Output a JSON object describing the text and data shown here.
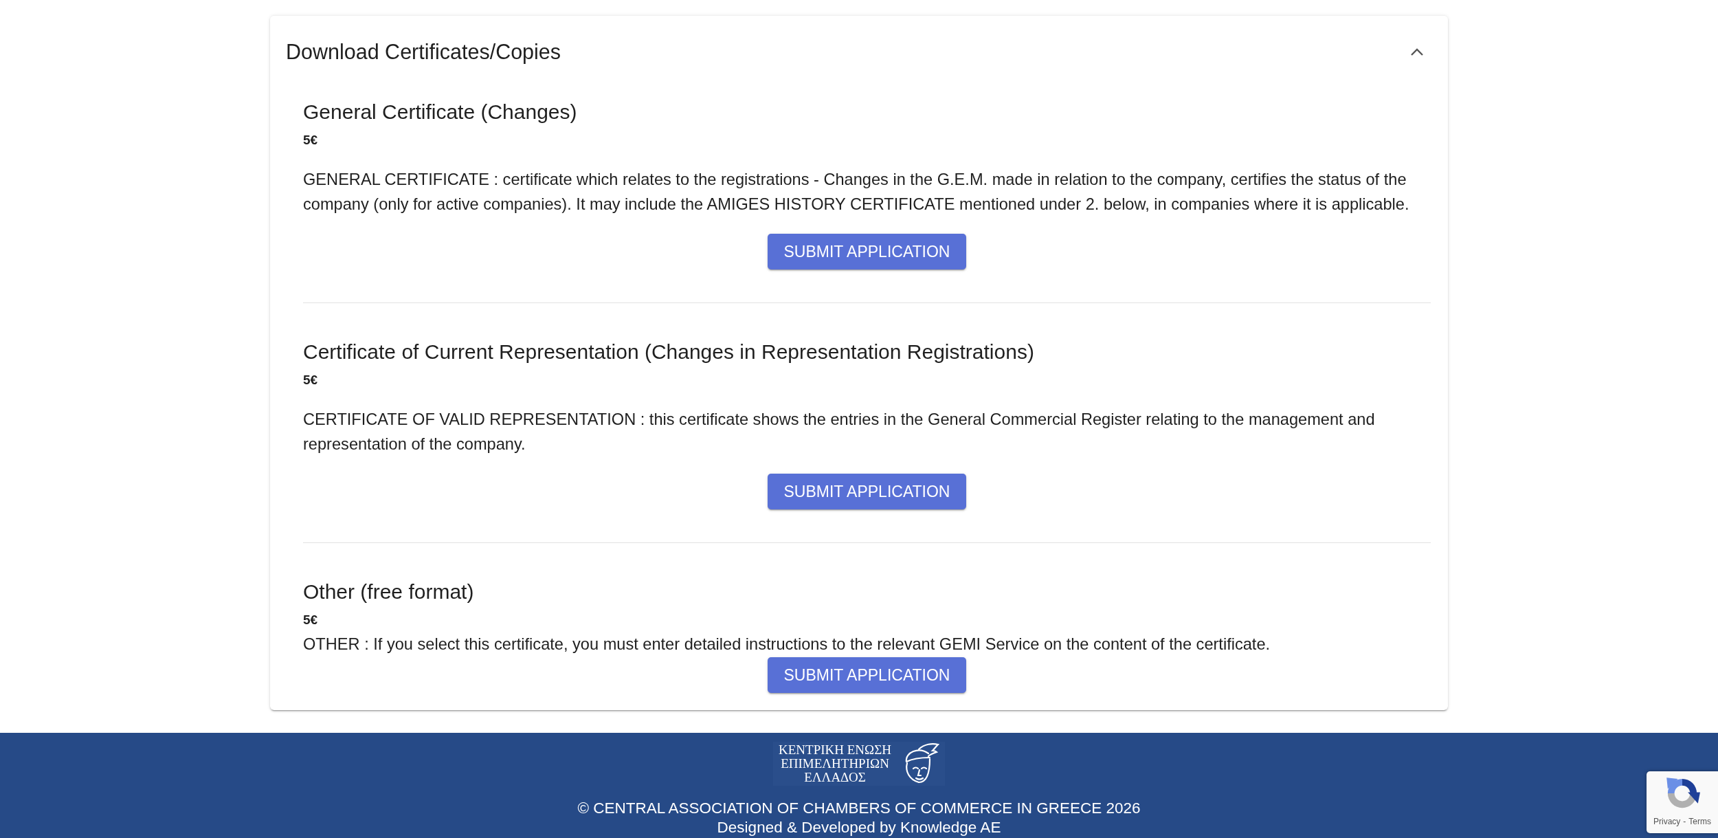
{
  "panel": {
    "title": "Download Certificates/Copies",
    "expanded": true
  },
  "certificates": [
    {
      "title": "General Certificate (Changes)",
      "price": "5€",
      "description": "GENERAL CERTIFICATE : certificate which relates to the registrations - Changes in the G.E.M. made in relation to the company, certifies the status of the company (only for active companies). It may include the AMIGES HISTORY CERTIFICATE mentioned under 2. below, in companies where it is applicable.",
      "button": "SUBMIT APPLICATION"
    },
    {
      "title": "Certificate of Current Representation (Changes in Representation Registrations)",
      "price": "5€",
      "description": "CERTIFICATE OF VALID REPRESENTATION : this certificate shows the entries in the General Commercial Register relating to the management and representation of the company.",
      "button": "SUBMIT APPLICATION"
    },
    {
      "title": "Other (free format)",
      "price": "5€",
      "description": "OTHER : If you select this certificate, you must enter detailed instructions to the relevant GEMI Service on the content of the certificate.",
      "button": "SUBMIT APPLICATION"
    }
  ],
  "footer": {
    "logo_lines": [
      "ΚΕΝΤΡΙΚΗ ΕΝΩΣΗ",
      "ΕΠΙΜΕΛΗΤΗΡΙΩΝ",
      "ΕΛΛΑΔΟΣ"
    ],
    "copyright": "© CENTRAL ASSOCIATION OF CHAMBERS OF COMMERCE IN GREECE 2026",
    "credits": "Designed & Developed by Knowledge AE"
  },
  "recaptcha": {
    "privacy": "Privacy",
    "separator": "-",
    "terms": "Terms"
  }
}
